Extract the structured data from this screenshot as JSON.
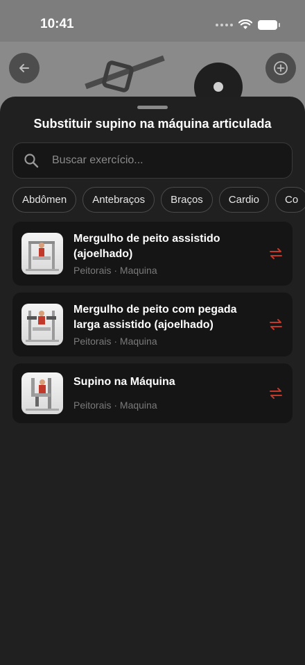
{
  "status": {
    "time": "10:41"
  },
  "header": {
    "back_icon": "arrow-left-icon",
    "add_icon": "plus-circle-icon"
  },
  "sheet": {
    "title": "Substituir supino na máquina articulada",
    "search": {
      "placeholder": "Buscar exercício...",
      "value": ""
    },
    "chips": [
      "Abdômen",
      "Antebraços",
      "Braços",
      "Cardio",
      "Co"
    ],
    "exercises": [
      {
        "title": "Mergulho de peito assistido (ajoelhado)",
        "muscle": "Peitorais",
        "equipment": "Maquina",
        "sub": "Peitorais · Maquina",
        "action_icon": "swap-icon"
      },
      {
        "title": "Mergulho de peito com pegada larga assistido (ajoelhado)",
        "muscle": "Peitorais",
        "equipment": "Maquina",
        "sub": "Peitorais · Maquina",
        "action_icon": "swap-icon"
      },
      {
        "title": "Supino na Máquina",
        "muscle": "Peitorais",
        "equipment": "Maquina",
        "sub": "Peitorais · Maquina",
        "action_icon": "swap-icon"
      }
    ]
  },
  "colors": {
    "sheet_bg": "#202020",
    "card_bg": "#151515",
    "accent_swap": "#c0392b",
    "muted_text": "#7a7a7a"
  }
}
